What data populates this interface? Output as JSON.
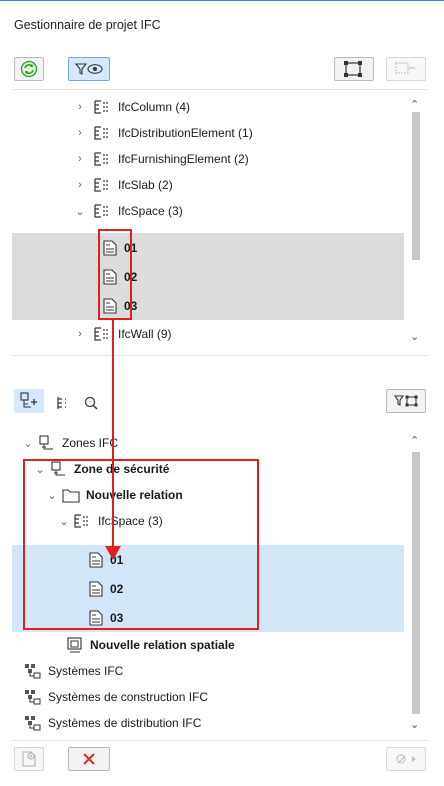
{
  "title": "Gestionnaire de projet IFC",
  "accent_color": "#3c7fd8",
  "annotation_color": "#e02020",
  "top_toolbar": {
    "refresh_icon": "refresh-icon",
    "filter_icon": "filter-eye-icon",
    "select_icon": "select-elements-icon",
    "link_icon": "link-icon"
  },
  "top_tree": {
    "items": [
      {
        "label": "IfcColumn (4)",
        "expanded": false
      },
      {
        "label": "IfcDistributionElement (1)",
        "expanded": false
      },
      {
        "label": "IfcFurnishingElement (2)",
        "expanded": false
      },
      {
        "label": "IfcSlab (2)",
        "expanded": false
      },
      {
        "label": "IfcSpace (3)",
        "expanded": true
      },
      {
        "label": "01",
        "child": true
      },
      {
        "label": "02",
        "child": true
      },
      {
        "label": "03",
        "child": true
      },
      {
        "label": "IfcWall (9)",
        "expanded": false
      }
    ]
  },
  "bottom_toolbar": {
    "tab_spatial": "spatial-tree-icon",
    "tab_type": "type-tree-icon",
    "search": "search-icon",
    "filter": "filter-icon"
  },
  "bottom_tree": {
    "items": [
      {
        "label": "Zones IFC"
      },
      {
        "label": "Zone de sécurité"
      },
      {
        "label": "Nouvelle relation"
      },
      {
        "label": "IfcSpace (3)"
      },
      {
        "label": "01"
      },
      {
        "label": "02"
      },
      {
        "label": "03"
      },
      {
        "label": "Nouvelle relation spatiale"
      },
      {
        "label": "Systèmes IFC"
      },
      {
        "label": "Systèmes de construction IFC"
      },
      {
        "label": "Systèmes de distribution IFC"
      }
    ]
  },
  "footer": {
    "add_icon": "add-document-icon",
    "delete_icon": "delete-icon",
    "more_icon": "more-options-icon"
  }
}
